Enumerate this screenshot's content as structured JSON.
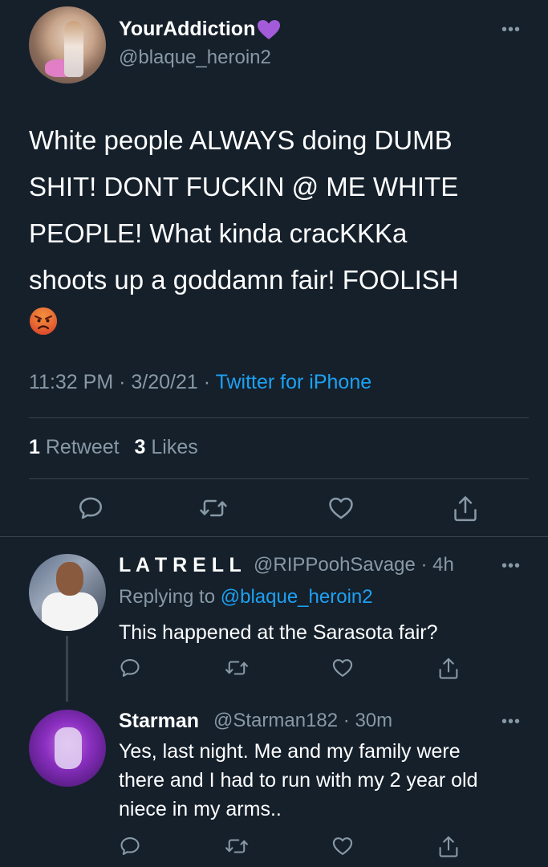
{
  "main_tweet": {
    "display_name": "YourAddiction",
    "name_emoji": "purple-heart-icon",
    "handle": "@blaque_heroin2",
    "text_lines": [
      "White people ALWAYS doing DUMB",
      "SHIT! DONT FUCKIN @ ME WHITE",
      "PEOPLE! What kinda cracKKKa",
      "shoots up a goddamn fair! FOOLISH"
    ],
    "trailing_emoji": "angry-face-icon",
    "time": "11:32 PM",
    "date": "3/20/21",
    "source": "Twitter for iPhone",
    "retweet_count": "1",
    "retweet_label": "Retweet",
    "like_count": "3",
    "like_label": "Likes"
  },
  "replies": [
    {
      "display_name": "L A T R E L L",
      "handle": "@RIPPoohSavage",
      "time": "4h",
      "replying_prefix": "Replying to",
      "replying_to": "@blaque_heroin2",
      "text_lines": [
        "This happened at the Sarasota fair?"
      ]
    },
    {
      "display_name": "Starman",
      "handle": "@Starman182",
      "time": "30m",
      "text_lines": [
        "Yes, last night.  Me and my family were",
        "there and I had to run with my 2 year old",
        "niece in my arms.."
      ]
    }
  ],
  "colors": {
    "background": "#15202b",
    "text_primary": "#ffffff",
    "text_secondary": "#8899a6",
    "accent": "#1da1f2",
    "divider": "#38444d",
    "heart_emoji": "#a35bd9"
  },
  "icons": {
    "reply": "reply-icon",
    "retweet": "retweet-icon",
    "like": "like-icon",
    "share": "share-icon",
    "more": "more-icon"
  }
}
